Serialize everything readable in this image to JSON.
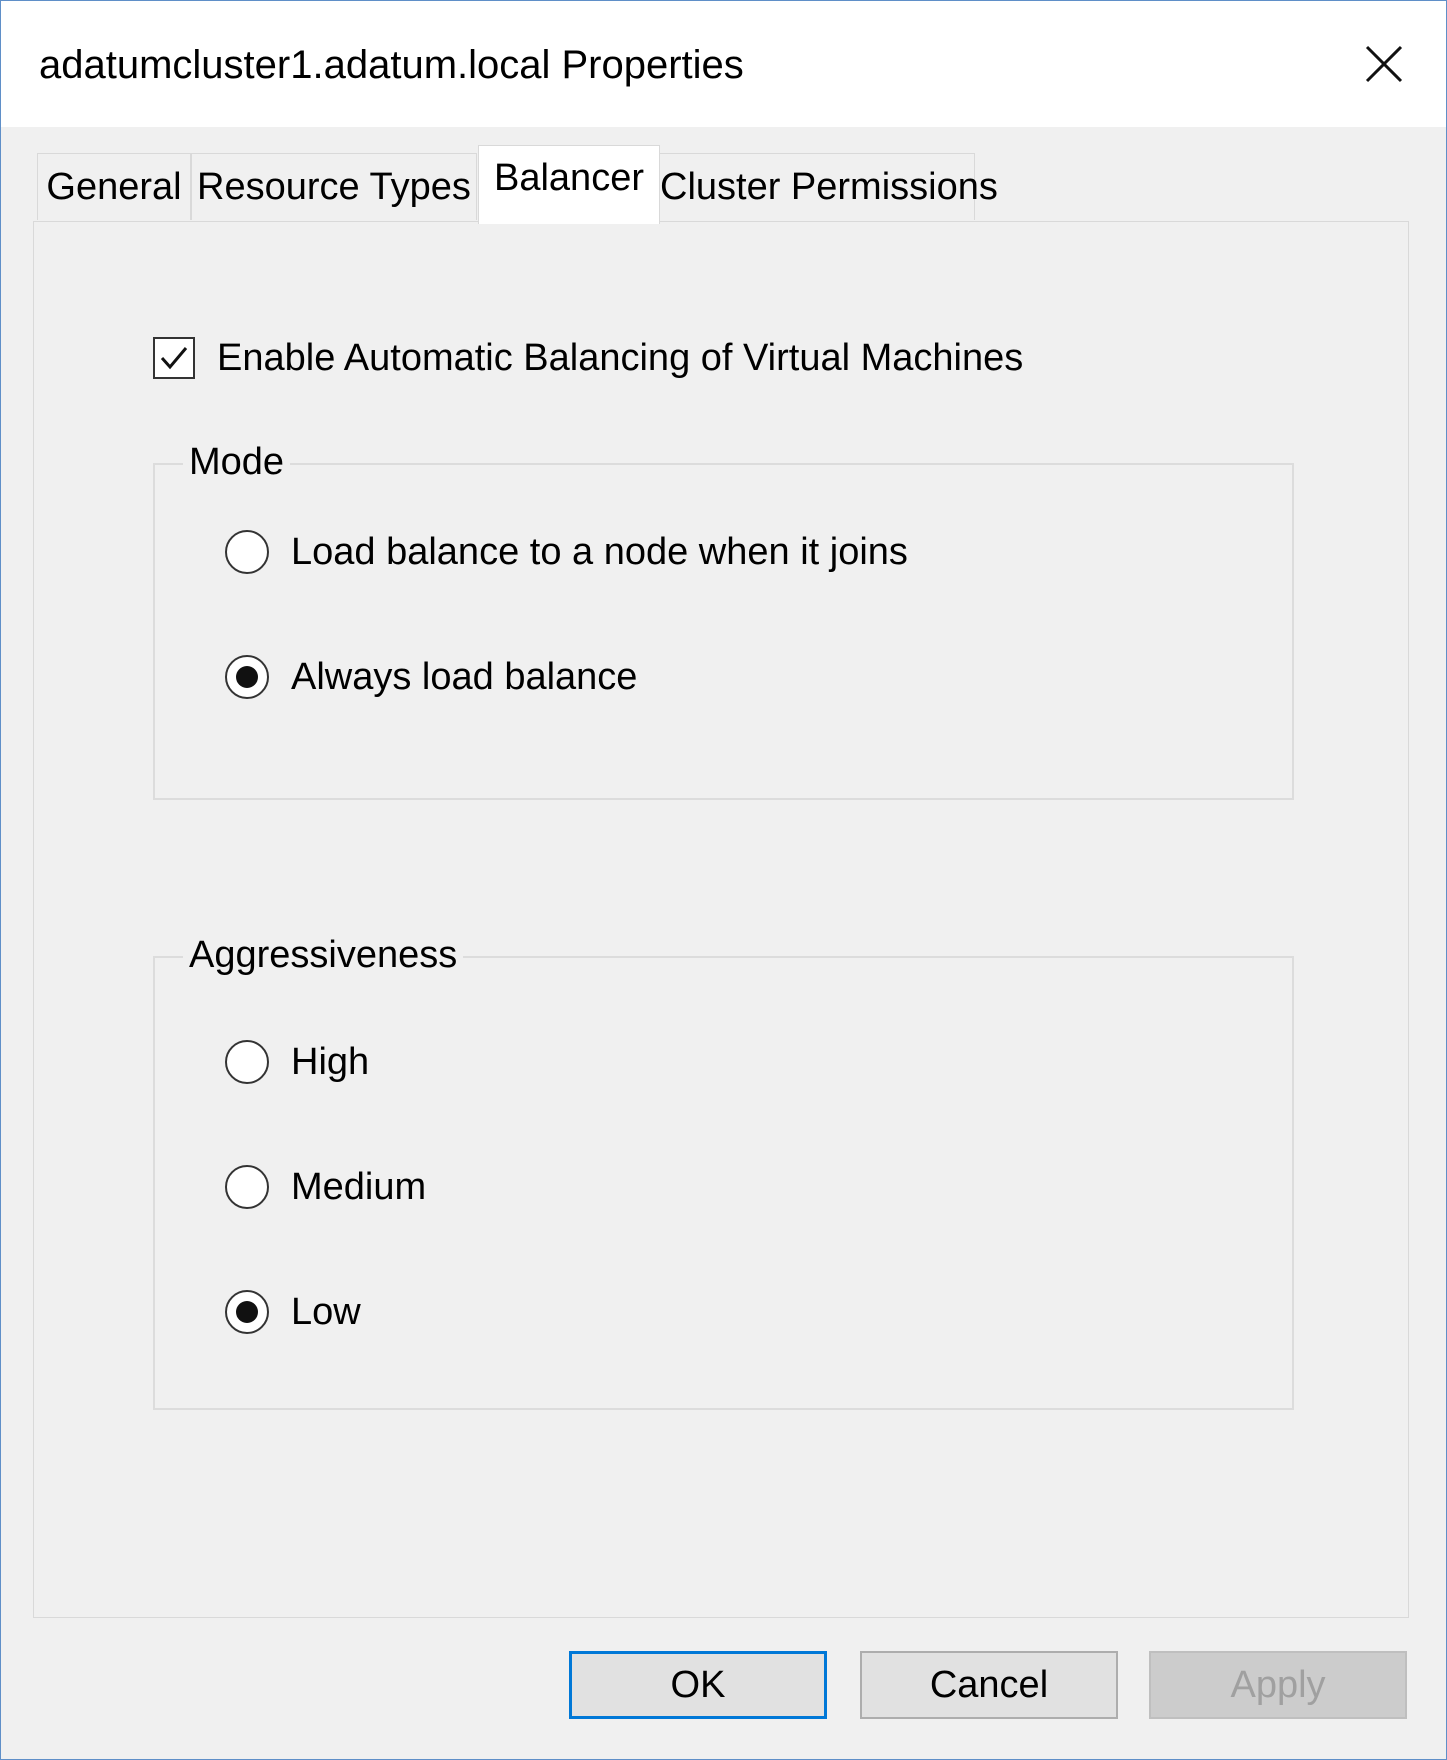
{
  "window": {
    "title": "adatumcluster1.adatum.local Properties",
    "close_icon": "close-icon"
  },
  "tabs": [
    {
      "label": "General",
      "selected": false
    },
    {
      "label": "Resource Types",
      "selected": false
    },
    {
      "label": "Balancer",
      "selected": true
    },
    {
      "label": "Cluster Permissions",
      "selected": false
    }
  ],
  "balancer": {
    "enable_checkbox": {
      "label": "Enable Automatic Balancing of Virtual Machines",
      "checked": true
    },
    "mode": {
      "legend": "Mode",
      "options": [
        {
          "label": "Load balance to a node when it joins",
          "selected": false
        },
        {
          "label": "Always load balance",
          "selected": true
        }
      ]
    },
    "aggressiveness": {
      "legend": "Aggressiveness",
      "options": [
        {
          "label": "High",
          "selected": false
        },
        {
          "label": "Medium",
          "selected": false
        },
        {
          "label": "Low",
          "selected": true
        }
      ]
    }
  },
  "buttons": {
    "ok": "OK",
    "cancel": "Cancel",
    "apply": "Apply",
    "apply_enabled": false
  },
  "colors": {
    "accent": "#0078d7",
    "dialog_background": "#f0f0f0",
    "window_border": "#5f8fc8"
  }
}
